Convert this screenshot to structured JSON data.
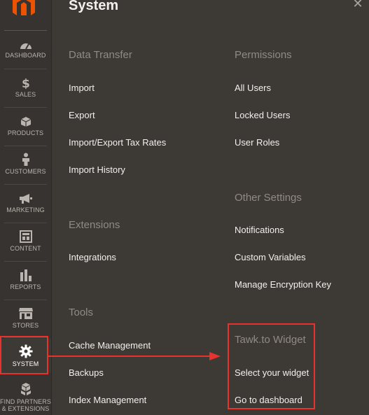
{
  "sidebar": {
    "items": [
      {
        "label": "DASHBOARD",
        "icon": "dashboard-icon"
      },
      {
        "label": "SALES",
        "icon": "dollar-icon"
      },
      {
        "label": "PRODUCTS",
        "icon": "cube-icon"
      },
      {
        "label": "CUSTOMERS",
        "icon": "person-icon"
      },
      {
        "label": "MARKETING",
        "icon": "megaphone-icon"
      },
      {
        "label": "CONTENT",
        "icon": "layout-icon"
      },
      {
        "label": "REPORTS",
        "icon": "bar-chart-icon"
      },
      {
        "label": "STORES",
        "icon": "storefront-icon"
      },
      {
        "label": "SYSTEM",
        "icon": "gear-icon"
      },
      {
        "label_line1": "FIND PARTNERS",
        "label_line2": "& EXTENSIONS",
        "icon": "cubes-icon"
      }
    ]
  },
  "panel": {
    "title": "System",
    "close": "✕"
  },
  "sections": {
    "data_transfer": {
      "title": "Data Transfer",
      "links": [
        "Import",
        "Export",
        "Import/Export Tax Rates",
        "Import History"
      ]
    },
    "extensions": {
      "title": "Extensions",
      "links": [
        "Integrations"
      ]
    },
    "tools": {
      "title": "Tools",
      "links": [
        "Cache Management",
        "Backups",
        "Index Management"
      ]
    },
    "permissions": {
      "title": "Permissions",
      "links": [
        "All Users",
        "Locked Users",
        "User Roles"
      ]
    },
    "other_settings": {
      "title": "Other Settings",
      "links": [
        "Notifications",
        "Custom Variables",
        "Manage Encryption Key"
      ]
    },
    "tawk": {
      "title": "Tawk.to Widget",
      "links": [
        "Select your widget",
        "Go to dashboard"
      ]
    }
  },
  "colors": {
    "highlight": "#e8322e",
    "brand": "#eb5202"
  }
}
